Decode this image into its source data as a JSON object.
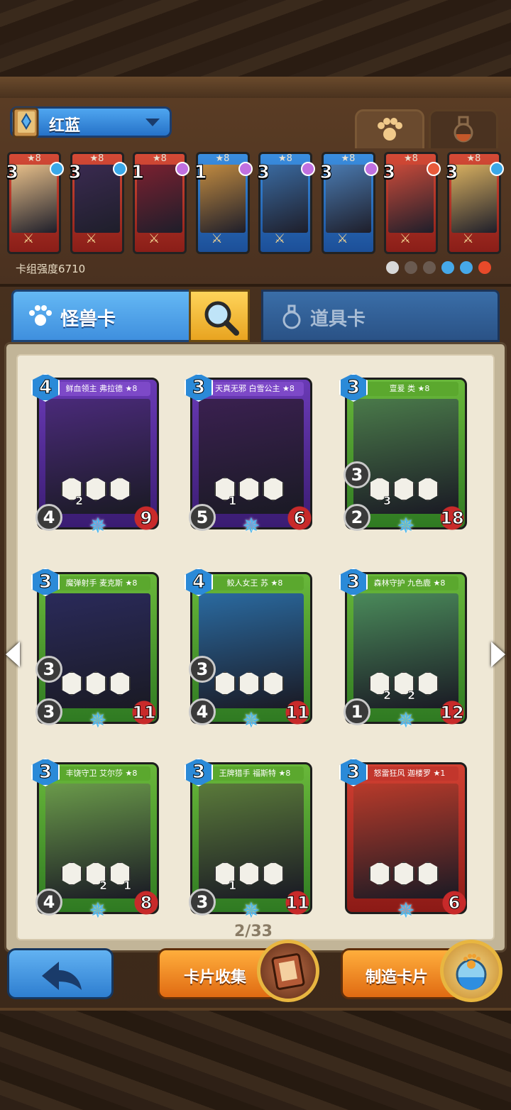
{
  "deck": {
    "name": "红蓝",
    "power_label": "卡组强度6710",
    "cards": [
      {
        "star": "★8",
        "cost": "3",
        "color": "red",
        "gem": "#3aa8e8"
      },
      {
        "star": "★8",
        "cost": "3",
        "color": "red",
        "gem": "#3aa8e8"
      },
      {
        "star": "★8",
        "cost": "1",
        "color": "red",
        "gem": "#c070e0"
      },
      {
        "star": "★8",
        "cost": "1",
        "color": "blue",
        "gem": "#c070e0"
      },
      {
        "star": "★8",
        "cost": "3",
        "color": "blue",
        "gem": "#c070e0"
      },
      {
        "star": "★8",
        "cost": "3",
        "color": "blue",
        "gem": "#c070e0"
      },
      {
        "star": "★8",
        "cost": "3",
        "color": "red",
        "gem": "#e85a3a"
      },
      {
        "star": "★8",
        "cost": "3",
        "color": "red",
        "gem": "#3aa8e8"
      }
    ],
    "elements": [
      "neutral-icon",
      "dark-icon",
      "earth-icon",
      "water-icon",
      "wind-icon",
      "fire-icon"
    ]
  },
  "tabs": {
    "monster": "怪兽卡",
    "prop": "道具卡"
  },
  "cards": [
    {
      "title": "鲜血领主 弗拉德 ★8",
      "cost": "4",
      "attack": "4",
      "hp": "9",
      "color": "purple",
      "armor": "",
      "slots": [
        "2",
        "",
        ""
      ]
    },
    {
      "title": "天真无邪 白雪公主 ★8",
      "cost": "3",
      "attack": "5",
      "hp": "6",
      "color": "purple",
      "armor": "",
      "slots": [
        "1",
        "",
        ""
      ]
    },
    {
      "title": "亶爰 类 ★8",
      "cost": "3",
      "attack": "2",
      "hp": "18",
      "color": "green",
      "armor": "3",
      "slots": [
        "3",
        "",
        ""
      ]
    },
    {
      "title": "魔弹射手 麦克斯 ★8",
      "cost": "3",
      "attack": "3",
      "hp": "11",
      "color": "green",
      "armor": "3",
      "slots": [
        "",
        "",
        ""
      ]
    },
    {
      "title": "鲛人女王 苏 ★8",
      "cost": "4",
      "attack": "4",
      "hp": "11",
      "color": "green",
      "armor": "3",
      "slots": [
        "",
        "",
        ""
      ]
    },
    {
      "title": "森林守护 九色鹿 ★8",
      "cost": "3",
      "attack": "1",
      "hp": "12",
      "color": "green",
      "armor": "",
      "slots": [
        "2",
        "2",
        ""
      ]
    },
    {
      "title": "丰饶守卫 艾尔莎 ★8",
      "cost": "3",
      "attack": "4",
      "hp": "8",
      "color": "green",
      "armor": "",
      "slots": [
        "",
        "2",
        "1"
      ]
    },
    {
      "title": "王牌猎手 福斯特 ★8",
      "cost": "3",
      "attack": "3",
      "hp": "11",
      "color": "green",
      "armor": "",
      "slots": [
        "1",
        "",
        ""
      ]
    },
    {
      "title": "怒雷狂风 迦楼罗 ★1",
      "cost": "3",
      "attack": "",
      "hp": "6",
      "color": "red",
      "armor": "",
      "slots": [
        "",
        "",
        ""
      ]
    }
  ],
  "pagination": {
    "text": "2/33"
  },
  "buttons": {
    "collect": "卡片收集",
    "craft": "制造卡片"
  },
  "colors": {
    "accent_blue": "#3f8fde",
    "accent_orange": "#e06a12",
    "parchment": "#efe8d6"
  }
}
